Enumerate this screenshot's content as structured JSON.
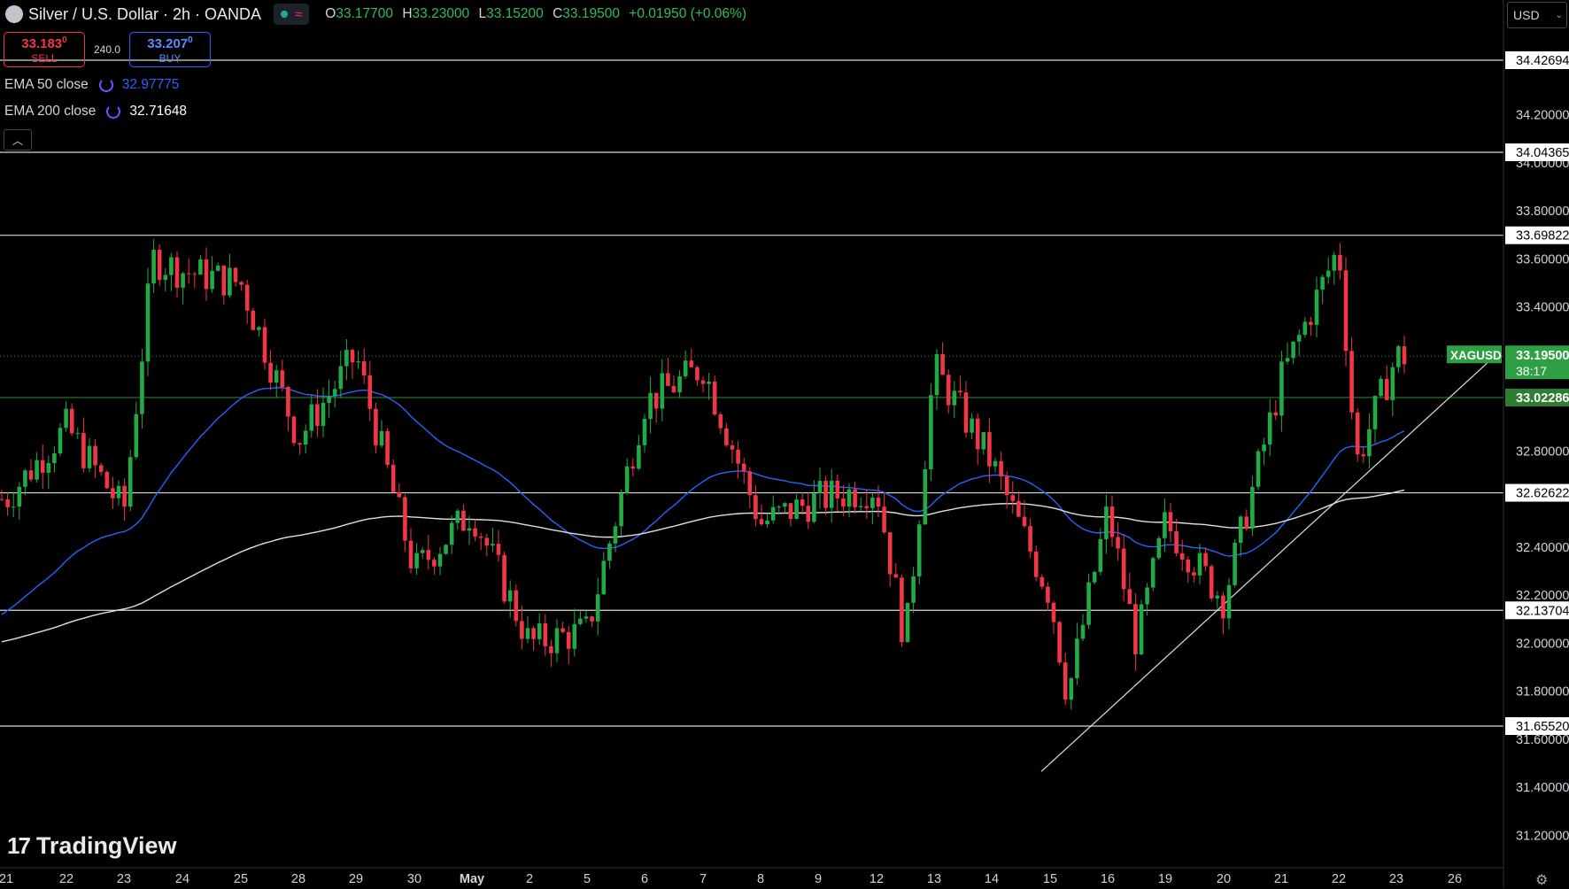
{
  "header": {
    "title": "Silver / U.S. Dollar · 2h · OANDA",
    "ohlc": [
      {
        "k": "O",
        "v": "33.17700"
      },
      {
        "k": "H",
        "v": "33.23000"
      },
      {
        "k": "L",
        "v": "33.15200"
      },
      {
        "k": "C",
        "v": "33.19500"
      }
    ],
    "change": "+0.01950 (+0.06%)"
  },
  "trade": {
    "sell_price": "33.183",
    "sell_sup": "0",
    "sell_label": "SELL",
    "spread": "240.0",
    "buy_price": "33.207",
    "buy_sup": "0",
    "buy_label": "BUY"
  },
  "indicators": [
    {
      "name": "EMA 50 close",
      "value": "32.97775",
      "color": "#2962ff"
    },
    {
      "name": "EMA 200 close",
      "value": "32.71648",
      "color": "#ffffff"
    }
  ],
  "currency": "USD",
  "logo": "TradingView",
  "colors": {
    "up": "#22ab44",
    "down": "#f23645",
    "ema50": "#2962ff",
    "ema200": "#e0e0e0",
    "price_line": "#22ab44"
  },
  "chart_data": {
    "type": "candlestick",
    "symbol": "XAGUSD",
    "timeframe": "2h",
    "ylim": [
      31.1,
      34.52
    ],
    "y_ticks": [
      "34.20000",
      "34.00000",
      "33.80000",
      "33.60000",
      "33.40000",
      "32.80000",
      "32.40000",
      "32.20000",
      "32.00000",
      "31.80000",
      "31.60000",
      "31.40000",
      "31.20000"
    ],
    "x_ticks": [
      "21",
      "22",
      "23",
      "24",
      "25",
      "28",
      "29",
      "30",
      "May",
      "2",
      "5",
      "6",
      "7",
      "8",
      "9",
      "12",
      "13",
      "14",
      "15",
      "16",
      "19",
      "20",
      "21",
      "22",
      "23",
      "26"
    ],
    "horizontal_levels": [
      "34.42694",
      "34.04365",
      "33.69822",
      "32.62622",
      "32.13704",
      "31.65520"
    ],
    "support_level": "33.02286",
    "last_price": "33.19500",
    "countdown": "38:17",
    "trendline": [
      {
        "x": "15",
        "y": 31.5
      },
      {
        "x": "23",
        "y": 32.82
      }
    ],
    "anchors": [
      {
        "x": "21",
        "y": 32.6
      },
      {
        "x": "22",
        "y": 32.9
      },
      {
        "x": "23",
        "y": 32.55
      },
      {
        "x": "23.5",
        "y": 33.6
      },
      {
        "x": "24",
        "y": 33.55
      },
      {
        "x": "25",
        "y": 33.5
      },
      {
        "x": "28",
        "y": 32.85
      },
      {
        "x": "29",
        "y": 33.2
      },
      {
        "x": "30",
        "y": 32.3
      },
      {
        "x": "May",
        "y": 32.55
      },
      {
        "x": "2",
        "y": 32.0
      },
      {
        "x": "5",
        "y": 32.05
      },
      {
        "x": "6",
        "y": 33.0
      },
      {
        "x": "7",
        "y": 33.15
      },
      {
        "x": "8",
        "y": 32.5
      },
      {
        "x": "9",
        "y": 32.6
      },
      {
        "x": "12",
        "y": 32.65
      },
      {
        "x": "12.5",
        "y": 32.0
      },
      {
        "x": "13",
        "y": 33.15
      },
      {
        "x": "14",
        "y": 32.75
      },
      {
        "x": "15",
        "y": 32.2
      },
      {
        "x": "15.3",
        "y": 31.78
      },
      {
        "x": "16",
        "y": 32.55
      },
      {
        "x": "16.5",
        "y": 32.0
      },
      {
        "x": "19",
        "y": 32.5
      },
      {
        "x": "20",
        "y": 32.18
      },
      {
        "x": "21",
        "y": 33.1
      },
      {
        "x": "22",
        "y": 33.65
      },
      {
        "x": "22.3",
        "y": 32.75
      },
      {
        "x": "23",
        "y": 33.195
      }
    ]
  }
}
